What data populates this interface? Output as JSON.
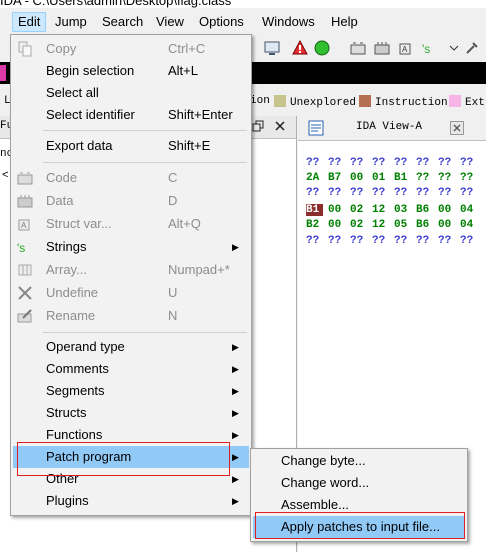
{
  "window": {
    "title": "IDA - C:\\Users\\admin\\Desktop\\flag.class"
  },
  "menubar": [
    {
      "label": "Edit"
    },
    {
      "label": "Jump"
    },
    {
      "label": "Search"
    },
    {
      "label": "View"
    },
    {
      "label": "Options"
    },
    {
      "label": "Windows"
    },
    {
      "label": "Help"
    }
  ],
  "toolbar_icons": [
    "flag-icon",
    "screen-icon",
    "stop-icon",
    "run-icon",
    "code-icon",
    "data-icon",
    "struct-icon",
    "strings-icon"
  ],
  "legend": [
    {
      "label": "ion",
      "color": "#b0b0b0"
    },
    {
      "label": "Unexplored",
      "color": "#c6c48a"
    },
    {
      "label": "Instruction",
      "color": "#b56e52"
    },
    {
      "label": "Ext",
      "color": "#f7b4e6"
    }
  ],
  "left_panel": {
    "header_fragment": "Fu",
    "row1": "nc",
    "row2": "<"
  },
  "ida_view": {
    "tab_label": "IDA View-A",
    "rows": [
      {
        "bytes": [
          "??",
          "??",
          "??",
          "??",
          "??",
          "??",
          "??",
          "??"
        ],
        "color": "#4040d0"
      },
      {
        "bytes": [
          "2A",
          "B7",
          "00",
          "01",
          "B1",
          "??",
          "??",
          "??"
        ],
        "color": "#008000"
      },
      {
        "bytes": [
          "??",
          "??",
          "??",
          "??",
          "??",
          "??",
          "??",
          "??"
        ],
        "color": "#4040d0"
      },
      {
        "bytes": [
          "B1",
          "00",
          "02",
          "12",
          "03",
          "B6",
          "00",
          "04"
        ],
        "color": "#008000"
      },
      {
        "bytes": [
          "B2",
          "00",
          "02",
          "12",
          "05",
          "B6",
          "00",
          "04"
        ],
        "color": "#008000"
      },
      {
        "bytes": [
          "??",
          "??",
          "??",
          "??",
          "??",
          "??",
          "??",
          "??"
        ],
        "color": "#4040d0"
      }
    ]
  },
  "edit_menu": {
    "items": [
      {
        "label": "Copy",
        "shortcut": "Ctrl+C",
        "disabled": true,
        "icon": "copy-icon"
      },
      {
        "label": "Begin selection",
        "shortcut": "Alt+L"
      },
      {
        "label": "Select all",
        "shortcut": ""
      },
      {
        "label": "Select identifier",
        "shortcut": "Shift+Enter"
      },
      {
        "label": "Export data",
        "shortcut": "Shift+E"
      },
      {
        "label": "Code",
        "shortcut": "C",
        "disabled": true,
        "icon": "code-icon"
      },
      {
        "label": "Data",
        "shortcut": "D",
        "disabled": true,
        "icon": "data-icon"
      },
      {
        "label": "Struct var...",
        "shortcut": "Alt+Q",
        "disabled": true,
        "icon": "struct-icon"
      },
      {
        "label": "Strings",
        "shortcut": "",
        "submenu": true,
        "icon": "strings-icon"
      },
      {
        "label": "Array...",
        "shortcut": "Numpad+*",
        "disabled": true,
        "icon": "array-icon"
      },
      {
        "label": "Undefine",
        "shortcut": "U",
        "disabled": true,
        "icon": "undefine-icon"
      },
      {
        "label": "Rename",
        "shortcut": "N",
        "disabled": true,
        "icon": "rename-icon"
      },
      {
        "label": "Operand type",
        "submenu": true
      },
      {
        "label": "Comments",
        "submenu": true
      },
      {
        "label": "Segments",
        "submenu": true
      },
      {
        "label": "Structs",
        "submenu": true
      },
      {
        "label": "Functions",
        "submenu": true
      },
      {
        "label": "Patch program",
        "submenu": true,
        "highlighted": true
      },
      {
        "label": "Other",
        "submenu": true
      },
      {
        "label": "Plugins",
        "submenu": true
      }
    ]
  },
  "patch_submenu": {
    "items": [
      {
        "label": "Change byte..."
      },
      {
        "label": "Change word..."
      },
      {
        "label": "Assemble..."
      },
      {
        "label": "Apply patches to input file...",
        "highlighted": true
      }
    ]
  },
  "colors": {
    "highlight": "#91c9f7",
    "red_box": "#e02020",
    "dump_selected": "#8b2d2d"
  }
}
